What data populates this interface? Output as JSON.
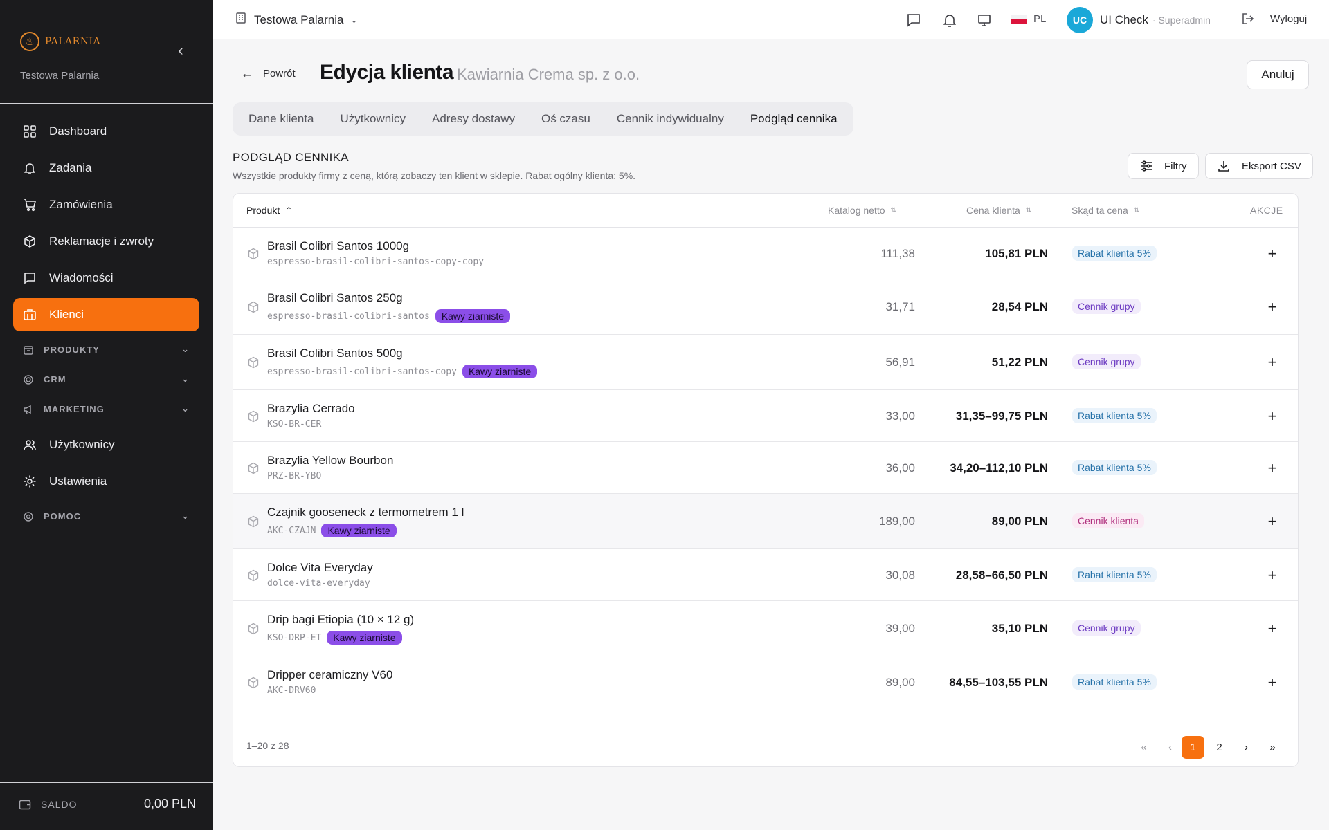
{
  "sidebar": {
    "logo_text": "PALARNIA",
    "org_name": "Testowa Palarnia",
    "nav": [
      {
        "label": "Dashboard",
        "icon": "dashboard-icon"
      },
      {
        "label": "Zadania",
        "icon": "bell-icon"
      },
      {
        "label": "Zamówienia",
        "icon": "cart-icon"
      },
      {
        "label": "Reklamacje i zwroty",
        "icon": "box-return-icon"
      },
      {
        "label": "Wiadomości",
        "icon": "message-icon"
      },
      {
        "label": "Klienci",
        "icon": "building-icon",
        "active": true
      }
    ],
    "sections": [
      {
        "label": "PRODUKTY",
        "icon": "package-icon"
      },
      {
        "label": "CRM",
        "icon": "target-icon"
      },
      {
        "label": "MARKETING",
        "icon": "megaphone-icon"
      }
    ],
    "nav2": [
      {
        "label": "Użytkownicy",
        "icon": "users-icon"
      },
      {
        "label": "Ustawienia",
        "icon": "gear-icon"
      }
    ],
    "help": {
      "label": "POMOC",
      "icon": "lifebuoy-icon"
    },
    "saldo": {
      "label": "SALDO",
      "value": "0,00 PLN"
    }
  },
  "topbar": {
    "org": "Testowa Palarnia",
    "lang": "PL",
    "user_initials": "UC",
    "user_name": "UI Check",
    "user_role": "· Superadmin",
    "logout": "Wyloguj"
  },
  "header": {
    "back": "Powrót",
    "title": "Edycja klienta",
    "subtitle": "Kawiarnia Crema sp. z o.o.",
    "cancel": "Anuluj"
  },
  "tabs": [
    "Dane klienta",
    "Użytkownicy",
    "Adresy dostawy",
    "Oś czasu",
    "Cennik indywidualny",
    "Podgląd cennika"
  ],
  "active_tab": "Podgląd cennika",
  "section": {
    "title": "PODGLĄD CENNIKA",
    "description": "Wszystkie produkty firmy z ceną, którą zobaczy ten klient w sklepie. Rabat ogólny klienta: 5%.",
    "filters": "Filtry",
    "export": "Eksport CSV"
  },
  "table": {
    "columns": {
      "product": "Produkt",
      "catalog": "Katalog netto",
      "client": "Cena klienta",
      "source": "Skąd ta cena",
      "actions": "AKCJE"
    },
    "rows": [
      {
        "name": "Brasil Colibri Santos 1000g",
        "sku": "espresso-brasil-colibri-santos-copy-copy",
        "tag": "",
        "catalog": "111,38",
        "client": "105,81 PLN",
        "source": "Rabat klienta 5%",
        "source_color": "blue"
      },
      {
        "name": "Brasil Colibri Santos 250g",
        "sku": "espresso-brasil-colibri-santos",
        "tag": "Kawy ziarniste",
        "catalog": "31,71",
        "client": "28,54 PLN",
        "source": "Cennik grupy",
        "source_color": "purple"
      },
      {
        "name": "Brasil Colibri Santos 500g",
        "sku": "espresso-brasil-colibri-santos-copy",
        "tag": "Kawy ziarniste",
        "catalog": "56,91",
        "client": "51,22 PLN",
        "source": "Cennik grupy",
        "source_color": "purple"
      },
      {
        "name": "Brazylia Cerrado",
        "sku": "KSO-BR-CER",
        "tag": "",
        "catalog": "33,00",
        "client": "31,35–99,75 PLN",
        "source": "Rabat klienta 5%",
        "source_color": "blue"
      },
      {
        "name": "Brazylia Yellow Bourbon",
        "sku": "PRZ-BR-YBO",
        "tag": "",
        "catalog": "36,00",
        "client": "34,20–112,10 PLN",
        "source": "Rabat klienta 5%",
        "source_color": "blue"
      },
      {
        "name": "Czajnik gooseneck z termometrem 1 l",
        "sku": "AKC-CZAJN",
        "tag": "Kawy ziarniste",
        "catalog": "189,00",
        "client": "89,00 PLN",
        "source": "Cennik klienta",
        "source_color": "pink"
      },
      {
        "name": "Dolce Vita Everyday",
        "sku": "dolce-vita-everyday",
        "tag": "",
        "catalog": "30,08",
        "client": "28,58–66,50 PLN",
        "source": "Rabat klienta 5%",
        "source_color": "blue"
      },
      {
        "name": "Drip bagi Etiopia (10 × 12 g)",
        "sku": "KSO-DRP-ET",
        "tag": "Kawy ziarniste",
        "catalog": "39,00",
        "client": "35,10 PLN",
        "source": "Cennik grupy",
        "source_color": "purple"
      },
      {
        "name": "Dripper ceramiczny V60",
        "sku": "AKC-DRV60",
        "tag": "",
        "catalog": "89,00",
        "client": "84,55–103,55 PLN",
        "source": "Rabat klienta 5%",
        "source_color": "blue"
      }
    ],
    "range": "1–20 z 28",
    "pages": [
      "1",
      "2"
    ],
    "current_page": "1"
  },
  "colors": {
    "accent": "#f7700f",
    "sidebar_bg": "#1b1b1d",
    "tag_purple": "#8b4ee8"
  }
}
